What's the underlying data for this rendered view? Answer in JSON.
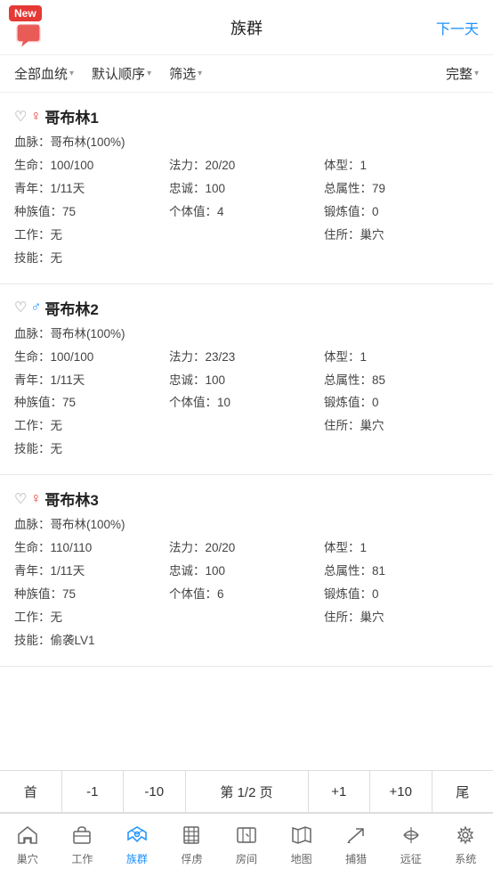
{
  "header": {
    "new_badge": "New",
    "title": "族群",
    "action": "下一天"
  },
  "filter_bar": {
    "items": [
      {
        "label": "全部血统",
        "arrow": "▼"
      },
      {
        "label": "默认顺序",
        "arrow": "▼"
      },
      {
        "label": "筛选",
        "arrow": "▼"
      },
      {
        "label": "完整",
        "arrow": "▼"
      }
    ]
  },
  "creatures": [
    {
      "name": "哥布林1",
      "gender": "female",
      "bloodline": "血脉：哥布林(100%)",
      "hp": "生命：100/100",
      "mp": "法力：20/20",
      "body": "体型：1",
      "youth": "青年：1/11天",
      "loyalty": "忠诚：100",
      "total_attr": "总属性：79",
      "race_val": "种族值：75",
      "individual": "个体值：4",
      "forge": "锻炼值：0",
      "work": "工作：无",
      "home": "住所：巢穴",
      "skill": "技能：无"
    },
    {
      "name": "哥布林2",
      "gender": "male",
      "bloodline": "血脉：哥布林(100%)",
      "hp": "生命：100/100",
      "mp": "法力：23/23",
      "body": "体型：1",
      "youth": "青年：1/11天",
      "loyalty": "忠诚：100",
      "total_attr": "总属性：85",
      "race_val": "种族值：75",
      "individual": "个体值：10",
      "forge": "锻炼值：0",
      "work": "工作：无",
      "home": "住所：巢穴",
      "skill": "技能：无"
    },
    {
      "name": "哥布林3",
      "gender": "female",
      "bloodline": "血脉：哥布林(100%)",
      "hp": "生命：110/110",
      "mp": "法力：20/20",
      "body": "体型：1",
      "youth": "青年：1/11天",
      "loyalty": "忠诚：100",
      "total_attr": "总属性：81",
      "race_val": "种族值：75",
      "individual": "个体值：6",
      "forge": "锻炼值：0",
      "work": "工作：无",
      "home": "住所：巢穴",
      "skill": "技能：偷袭LV1"
    }
  ],
  "pagination": {
    "first": "首",
    "prev1": "-1",
    "prev10": "-10",
    "info": "第 1/2 页",
    "next1": "+1",
    "next10": "+10",
    "last": "尾"
  },
  "nav": {
    "items": [
      {
        "label": "巢穴",
        "icon": "home",
        "active": false
      },
      {
        "label": "工作",
        "icon": "work",
        "active": false
      },
      {
        "label": "族群",
        "icon": "tribe",
        "active": true
      },
      {
        "label": "俘虏",
        "icon": "prisoner",
        "active": false
      },
      {
        "label": "房间",
        "icon": "room",
        "active": false
      },
      {
        "label": "地图",
        "icon": "map",
        "active": false
      },
      {
        "label": "捕猎",
        "icon": "hunt",
        "active": false
      },
      {
        "label": "远征",
        "icon": "expedition",
        "active": false
      },
      {
        "label": "系统",
        "icon": "system",
        "active": false
      }
    ]
  }
}
